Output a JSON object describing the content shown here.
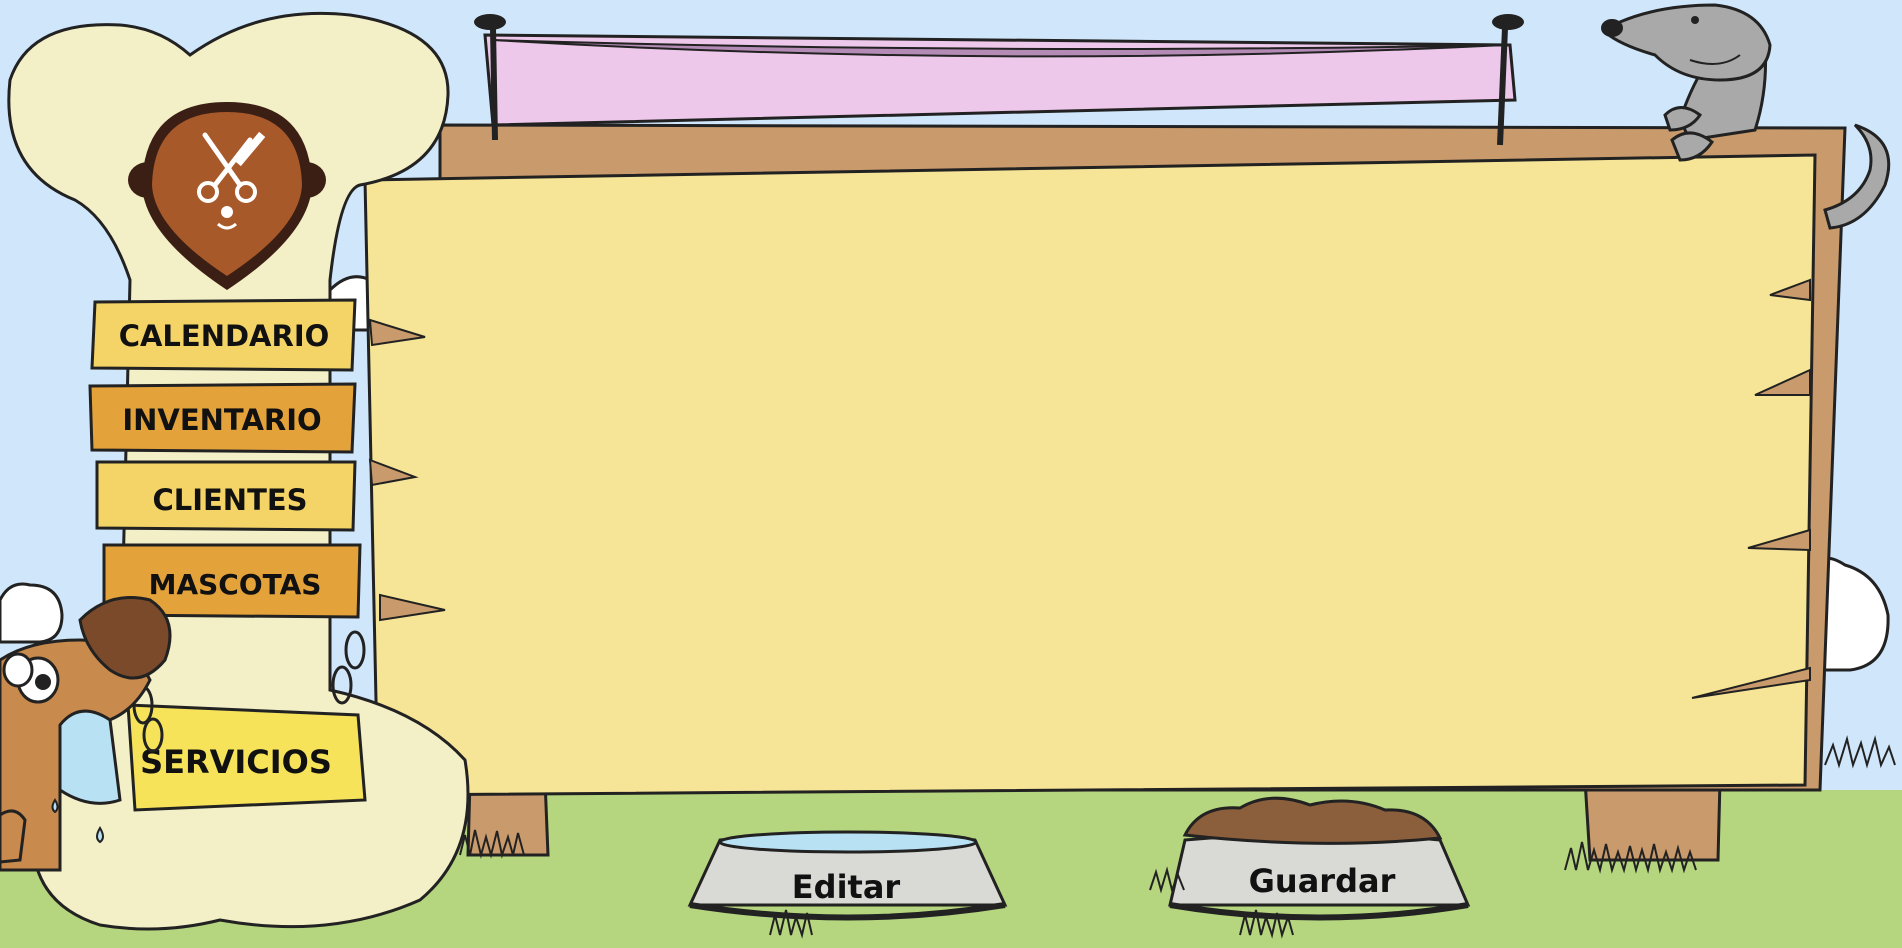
{
  "app": {
    "logo_icon": "scissors-comb-pet-grooming-icon",
    "brand_color": "#a8592a"
  },
  "nav": {
    "items": [
      {
        "label": "CALENDARIO",
        "icon": "none"
      },
      {
        "label": "INVENTARIO",
        "icon": "none"
      },
      {
        "label": "CLIENTES",
        "icon": "none"
      },
      {
        "label": "MASCOTAS",
        "icon": "none"
      },
      {
        "label": "SERVICIOS",
        "icon": "none"
      }
    ]
  },
  "banner": {
    "title": "",
    "color": "#eec8ea"
  },
  "board": {
    "content": "",
    "color": "#f7e597",
    "frame_color": "#c99a6b"
  },
  "actions": {
    "edit_label": "Editar",
    "save_label": "Guardar"
  },
  "colors": {
    "sky": "#cfe6fb",
    "grass": "#b6d57f",
    "bone": "#f3efc6",
    "nav_light": "#f4d466",
    "nav_dark": "#e4a23a"
  }
}
